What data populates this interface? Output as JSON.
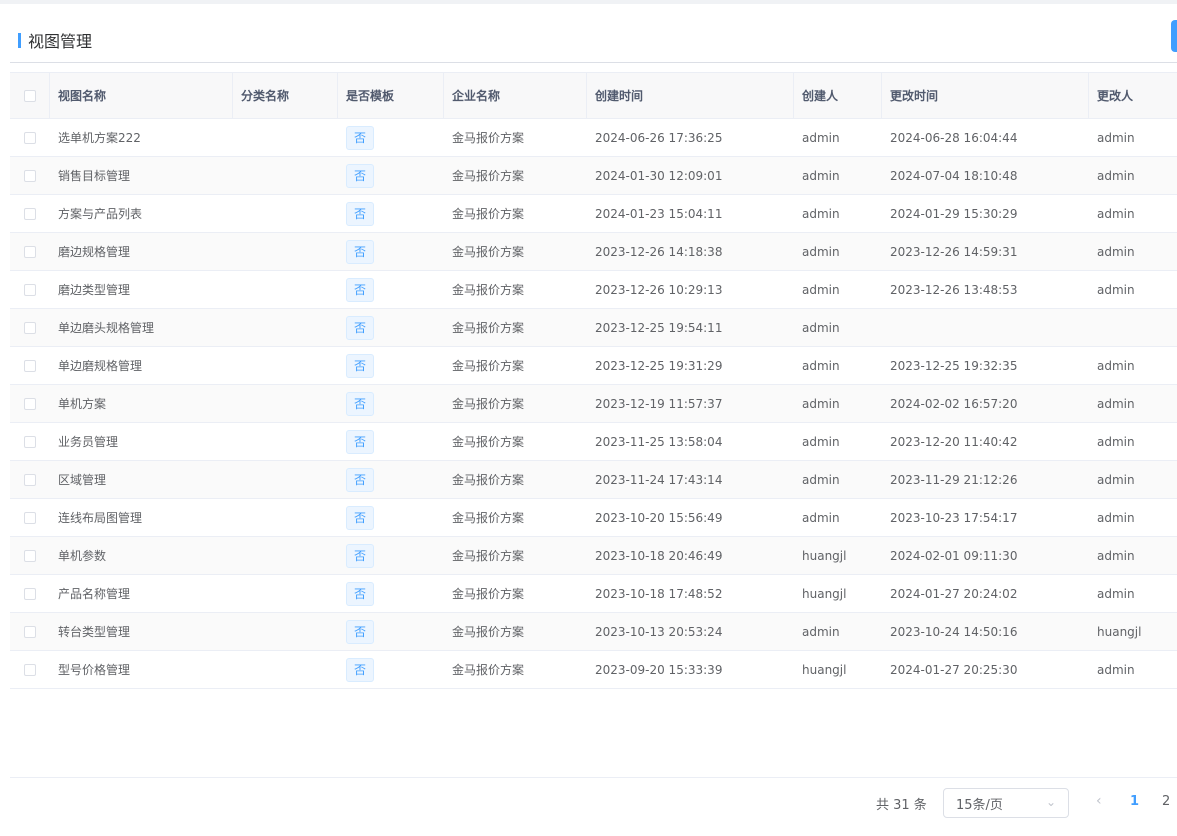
{
  "page": {
    "title": "视图管理"
  },
  "colors": {
    "accent": "#409eff",
    "tag_bg": "#ecf5ff"
  },
  "table": {
    "headers": [
      "视图名称",
      "分类名称",
      "是否模板",
      "企业名称",
      "创建时间",
      "创建人",
      "更改时间",
      "更改人"
    ],
    "rows": [
      {
        "name": "选单机方案222",
        "category": "",
        "template": "否",
        "company": "金马报价方案",
        "created": "2024-06-26 17:36:25",
        "creator": "admin",
        "updated": "2024-06-28 16:04:44",
        "updater": "admin"
      },
      {
        "name": "销售目标管理",
        "category": "",
        "template": "否",
        "company": "金马报价方案",
        "created": "2024-01-30 12:09:01",
        "creator": "admin",
        "updated": "2024-07-04 18:10:48",
        "updater": "admin"
      },
      {
        "name": "方案与产品列表",
        "category": "",
        "template": "否",
        "company": "金马报价方案",
        "created": "2024-01-23 15:04:11",
        "creator": "admin",
        "updated": "2024-01-29 15:30:29",
        "updater": "admin"
      },
      {
        "name": "磨边规格管理",
        "category": "",
        "template": "否",
        "company": "金马报价方案",
        "created": "2023-12-26 14:18:38",
        "creator": "admin",
        "updated": "2023-12-26 14:59:31",
        "updater": "admin"
      },
      {
        "name": "磨边类型管理",
        "category": "",
        "template": "否",
        "company": "金马报价方案",
        "created": "2023-12-26 10:29:13",
        "creator": "admin",
        "updated": "2023-12-26 13:48:53",
        "updater": "admin"
      },
      {
        "name": "单边磨头规格管理",
        "category": "",
        "template": "否",
        "company": "金马报价方案",
        "created": "2023-12-25 19:54:11",
        "creator": "admin",
        "updated": "",
        "updater": ""
      },
      {
        "name": "单边磨规格管理",
        "category": "",
        "template": "否",
        "company": "金马报价方案",
        "created": "2023-12-25 19:31:29",
        "creator": "admin",
        "updated": "2023-12-25 19:32:35",
        "updater": "admin"
      },
      {
        "name": "单机方案",
        "category": "",
        "template": "否",
        "company": "金马报价方案",
        "created": "2023-12-19 11:57:37",
        "creator": "admin",
        "updated": "2024-02-02 16:57:20",
        "updater": "admin"
      },
      {
        "name": "业务员管理",
        "category": "",
        "template": "否",
        "company": "金马报价方案",
        "created": "2023-11-25 13:58:04",
        "creator": "admin",
        "updated": "2023-12-20 11:40:42",
        "updater": "admin"
      },
      {
        "name": "区域管理",
        "category": "",
        "template": "否",
        "company": "金马报价方案",
        "created": "2023-11-24 17:43:14",
        "creator": "admin",
        "updated": "2023-11-29 21:12:26",
        "updater": "admin"
      },
      {
        "name": "连线布局图管理",
        "category": "",
        "template": "否",
        "company": "金马报价方案",
        "created": "2023-10-20 15:56:49",
        "creator": "admin",
        "updated": "2023-10-23 17:54:17",
        "updater": "admin"
      },
      {
        "name": "单机参数",
        "category": "",
        "template": "否",
        "company": "金马报价方案",
        "created": "2023-10-18 20:46:49",
        "creator": "huangjl",
        "updated": "2024-02-01 09:11:30",
        "updater": "admin"
      },
      {
        "name": "产品名称管理",
        "category": "",
        "template": "否",
        "company": "金马报价方案",
        "created": "2023-10-18 17:48:52",
        "creator": "huangjl",
        "updated": "2024-01-27 20:24:02",
        "updater": "admin"
      },
      {
        "name": "转台类型管理",
        "category": "",
        "template": "否",
        "company": "金马报价方案",
        "created": "2023-10-13 20:53:24",
        "creator": "admin",
        "updated": "2023-10-24 14:50:16",
        "updater": "huangjl"
      },
      {
        "name": "型号价格管理",
        "category": "",
        "template": "否",
        "company": "金马报价方案",
        "created": "2023-09-20 15:33:39",
        "creator": "huangjl",
        "updated": "2024-01-27 20:25:30",
        "updater": "admin"
      }
    ]
  },
  "pagination": {
    "total_label": "共 31 条",
    "page_size": "15条/页",
    "prev_icon": "chevron-left-icon",
    "pages": [
      "1",
      "2"
    ],
    "current_page": "1"
  }
}
